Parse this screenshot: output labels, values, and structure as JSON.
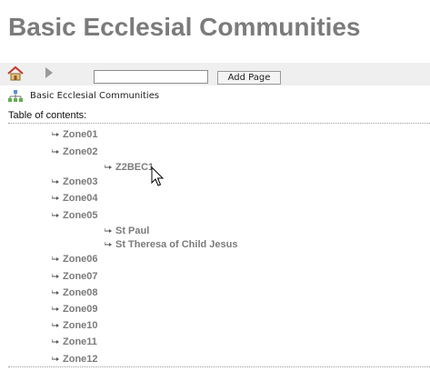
{
  "page": {
    "title": "Basic Ecclesial Communities"
  },
  "toolbar": {
    "home_icon": "home-icon",
    "forward_icon": "play-arrow-icon",
    "add_page_input_value": "",
    "add_page_label": "Add Page"
  },
  "breadcrumb": {
    "icon": "sitemap-icon",
    "label": "Basic Ecclesial Communities"
  },
  "toc": {
    "label": "Table of contents:",
    "items": [
      {
        "label": "Zone01"
      },
      {
        "label": "Zone02",
        "children": [
          {
            "label": "Z2BEC1"
          }
        ]
      },
      {
        "label": "Zone03"
      },
      {
        "label": "Zone04"
      },
      {
        "label": "Zone05",
        "children": [
          {
            "label": "St Paul"
          },
          {
            "label": "St Theresa of Child Jesus"
          }
        ]
      },
      {
        "label": "Zone06"
      },
      {
        "label": "Zone07"
      },
      {
        "label": "Zone08"
      },
      {
        "label": "Zone09"
      },
      {
        "label": "Zone10"
      },
      {
        "label": "Zone11"
      },
      {
        "label": "Zone12"
      }
    ]
  },
  "colors": {
    "title": "#7b7b7b",
    "toolbar_bg": "#efefef",
    "link": "#7b7b7b"
  }
}
